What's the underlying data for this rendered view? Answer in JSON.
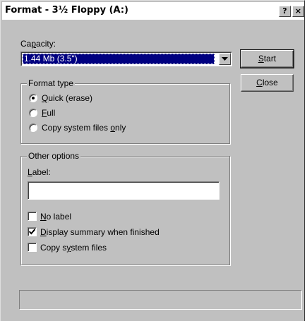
{
  "window": {
    "title": "Format - 3½ Floppy (A:)"
  },
  "titlebar": {
    "help_label": "?",
    "close_label": "×"
  },
  "capacity": {
    "label_pre": "Ca",
    "label_accel": "p",
    "label_post": "acity:",
    "selected": "1.44 Mb (3.5\")"
  },
  "buttons": {
    "start": {
      "accel": "S",
      "rest": "tart"
    },
    "close": {
      "accel": "C",
      "rest": "lose"
    }
  },
  "format_type": {
    "title": "Format type",
    "options": [
      {
        "pre": "",
        "accel": "Q",
        "post": "uick (erase)",
        "selected": true
      },
      {
        "pre": "",
        "accel": "F",
        "post": "ull",
        "selected": false
      },
      {
        "pre": "Copy system files ",
        "accel": "o",
        "post": "nly",
        "selected": false
      }
    ]
  },
  "other_options": {
    "title": "Other options",
    "label_field": {
      "pre": "",
      "accel": "L",
      "post": "abel:",
      "value": ""
    },
    "checkboxes": [
      {
        "pre": "",
        "accel": "N",
        "post": "o label",
        "checked": false
      },
      {
        "pre": "",
        "accel": "D",
        "post": "isplay summary when finished",
        "checked": true
      },
      {
        "pre": "Copy s",
        "accel": "y",
        "post": "stem files",
        "checked": false
      }
    ]
  },
  "status": {
    "text": ""
  }
}
